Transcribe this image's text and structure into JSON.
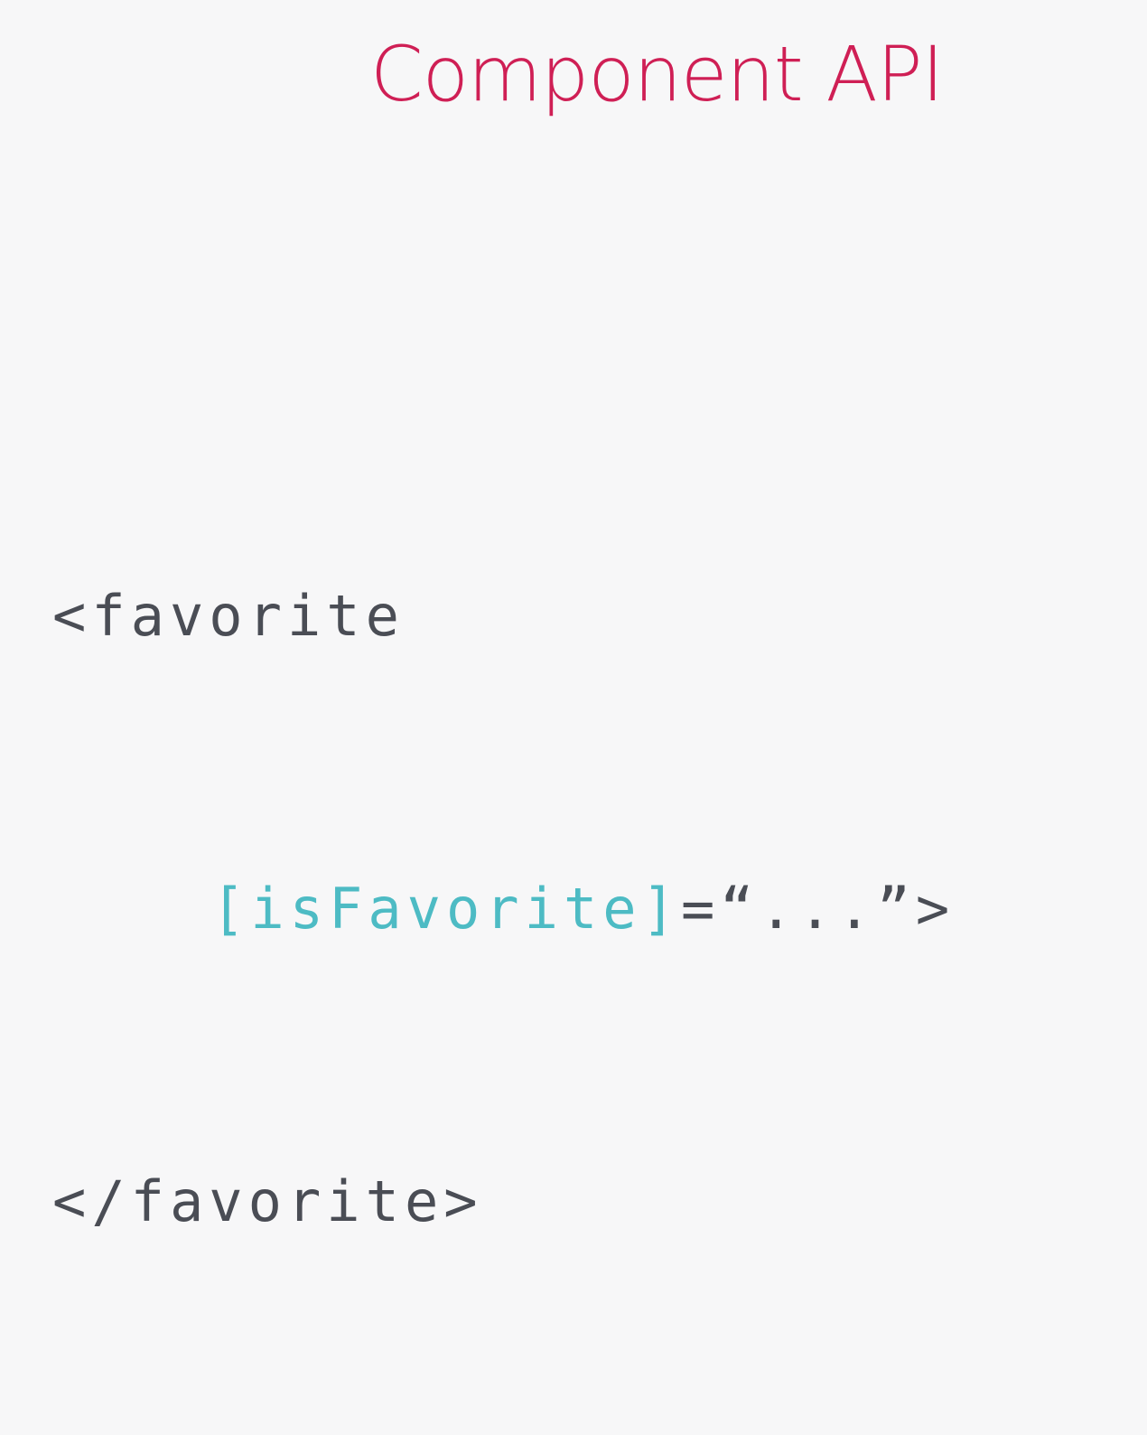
{
  "colors": {
    "background": "#f7f7f8",
    "title": "#cf1f55",
    "code_default": "#4a4d55",
    "code_attribute": "#4dbbc4"
  },
  "slide": {
    "title": "Component API",
    "code": {
      "line1": "<favorite",
      "line2_attribute": "[isFavorite]",
      "line2_value": "=“...”>",
      "line3": "</favorite>"
    }
  }
}
